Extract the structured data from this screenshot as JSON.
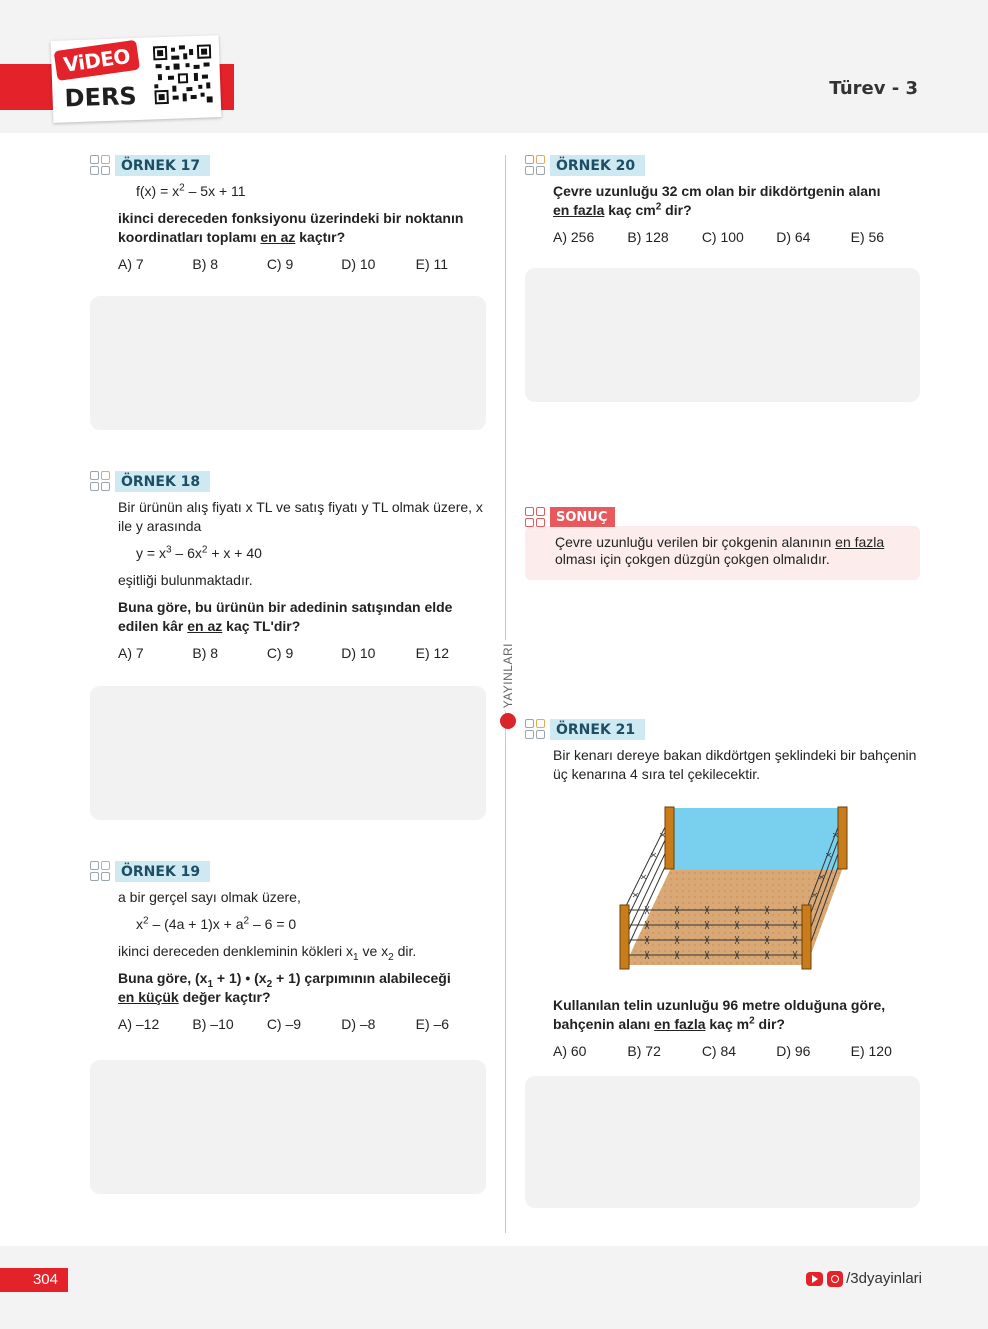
{
  "header": {
    "badge_video": "ViDEO",
    "badge_ders": "DERS",
    "qr_icon": "qr-code-icon",
    "chapter_title": "Türev - 3"
  },
  "ex17": {
    "label": "ÖRNEK 17",
    "formula_pre": "f(x) = x",
    "formula_sup": "2",
    "formula_post": " – 5x + 11",
    "q1": "ikinci dereceden fonksiyonu üzerindeki bir noktanın koordinatları toplamı ",
    "q_u": "en az",
    "q2": " kaçtır?",
    "options": [
      "A) 7",
      "B) 8",
      "C) 9",
      "D) 10",
      "E) 11"
    ]
  },
  "ex18": {
    "label": "ÖRNEK 18",
    "intro": "Bir ürünün alış fiyatı x TL ve satış fiyatı y TL olmak üzere, x ile y arasında",
    "f1": "y = x",
    "f1_sup": "3",
    "f2": " – 6x",
    "f2_sup": "2",
    "f3": " + x + 40",
    "note": "eşitliği bulunmaktadır.",
    "q1": "Buna göre, bu ürünün bir adedinin satışından elde edilen kâr ",
    "q_u": "en az",
    "q2": " kaç TL'dir?",
    "options": [
      "A) 7",
      "B) 8",
      "C) 9",
      "D) 10",
      "E) 12"
    ]
  },
  "ex19": {
    "label": "ÖRNEK 19",
    "intro": "a  bir gerçel sayı olmak üzere,",
    "f1": "x",
    "f1_sup": "2",
    "f2": " – (4a + 1)x + a",
    "f2_sup": "2",
    "f3": " – 6 = 0",
    "n1": "ikinci dereceden denkleminin kökleri x",
    "n_sub1": "1",
    "n2": " ve x",
    "n_sub2": "2",
    "n3": " dir.",
    "q1": "Buna göre, (x",
    "q_sub1": "1",
    "q2": " + 1) • (x",
    "q_sub2": "2",
    "q3": " + 1) çarpımının alabileceği",
    "q_u": "en küçük",
    "q4": " değer kaçtır?",
    "options": [
      "A) –12",
      "B) –10",
      "C) –9",
      "D) –8",
      "E) –6"
    ]
  },
  "ex20": {
    "label": "ÖRNEK 20",
    "q1": "Çevre uzunluğu 32 cm olan bir dikdörtgenin alanı",
    "q_u": "en fazla",
    "q2": " kaç cm",
    "q_sup": "2",
    "q3": " dir?",
    "options": [
      "A) 256",
      "B) 128",
      "C) 100",
      "D) 64",
      "E) 56"
    ]
  },
  "sonuc": {
    "label": "SONUÇ",
    "t1": "Çevre uzunluğu verilen bir çokgenin alanının ",
    "t_u": "en fazla",
    "t2": " olması için çokgen düzgün çokgen olmalıdır."
  },
  "ex21": {
    "label": "ÖRNEK 21",
    "intro": "Bir kenarı dereye bakan dikdörtgen şeklindeki bir bahçenin üç kenarına 4 sıra tel çekilecektir.",
    "q1": "Kullanılan telin uzunluğu 96 metre olduğuna göre, bahçenin alanı ",
    "q_u": "en fazla",
    "q2": " kaç m",
    "q_sup": "2",
    "q3": " dir?",
    "options": [
      "A) 60",
      "B) 72",
      "C) 84",
      "D) 96",
      "E) 120"
    ]
  },
  "brand": {
    "vertical": "YAYINLARI"
  },
  "footer": {
    "page_number": "304",
    "social": "/3dyayinlari"
  },
  "colors": {
    "accent_red": "#e4222a",
    "label_blue": "#cfe9f3",
    "work_gray": "#f2f2f3"
  }
}
